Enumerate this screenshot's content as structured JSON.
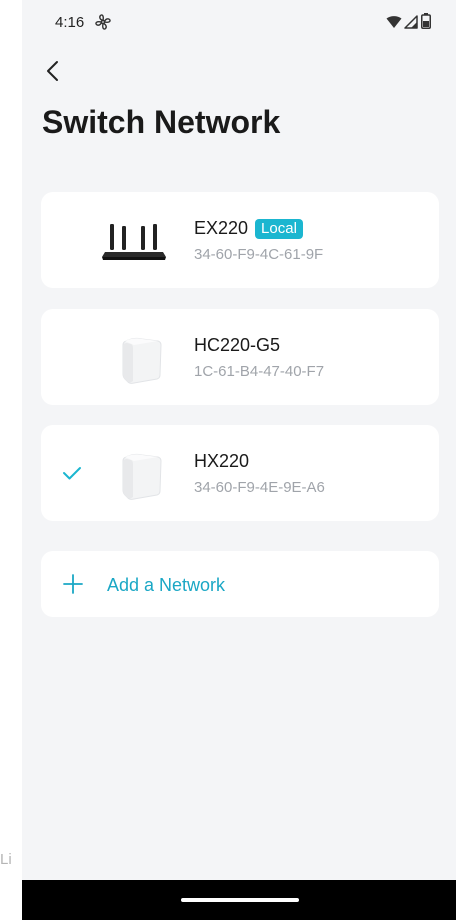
{
  "status_bar": {
    "time": "4:16",
    "icons": [
      "fan-icon",
      "wifi-icon",
      "signal-icon",
      "battery-icon"
    ]
  },
  "header": {
    "back_icon": "chevron-left-icon",
    "title": "Switch Network"
  },
  "networks": [
    {
      "name": "EX220",
      "badge": "Local",
      "mac": "34-60-F9-4C-61-9F",
      "device_icon": "router-icon",
      "selected": false
    },
    {
      "name": "HC220-G5",
      "mac": "1C-61-B4-47-40-F7",
      "device_icon": "mesh-unit-icon",
      "selected": false
    },
    {
      "name": "HX220",
      "mac": "34-60-F9-4E-9E-A6",
      "device_icon": "mesh-unit-icon",
      "selected": true
    }
  ],
  "add_network": {
    "label": "Add a Network",
    "icon": "plus-icon"
  },
  "edge_text": "Li",
  "colors": {
    "accent": "#1bb6d0",
    "background": "#f4f5f7",
    "card": "#ffffff",
    "nav_bar": "#000000"
  }
}
